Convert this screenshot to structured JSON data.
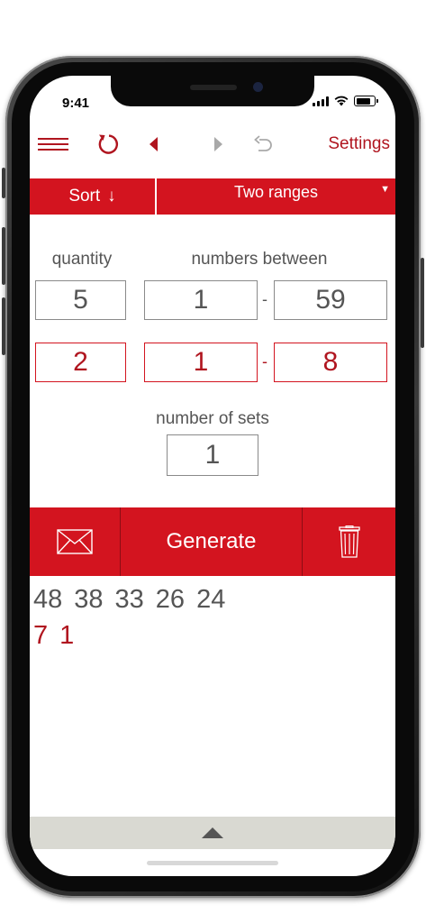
{
  "status_bar": {
    "time": "9:41"
  },
  "toolbar": {
    "icons": [
      "menu-icon",
      "refresh-icon",
      "prev-icon",
      "next-icon",
      "undo-icon"
    ],
    "settings_label": "Settings"
  },
  "options_bar": {
    "sort_label": "Sort",
    "sort_arrow": "↓",
    "mode_label": "Two ranges",
    "mode_caret": "▼"
  },
  "form": {
    "quantity_label": "quantity",
    "between_label": "numbers between",
    "range1": {
      "quantity": "5",
      "min": "1",
      "separator": "-",
      "max": "59"
    },
    "range2": {
      "quantity": "2",
      "min": "1",
      "separator": "-",
      "max": "8"
    },
    "sets_label": "number of sets",
    "sets_value": "1"
  },
  "actions": {
    "generate_label": "Generate",
    "icons": [
      "mail-icon",
      "trash-icon"
    ]
  },
  "results": {
    "line1": [
      "48",
      "38",
      "33",
      "26",
      "24"
    ],
    "line2": [
      "7",
      "1"
    ]
  },
  "colors": {
    "accent": "#d3141f",
    "accent_text": "#b0151f",
    "text": "#555555",
    "panel": "#d9d9d2"
  }
}
